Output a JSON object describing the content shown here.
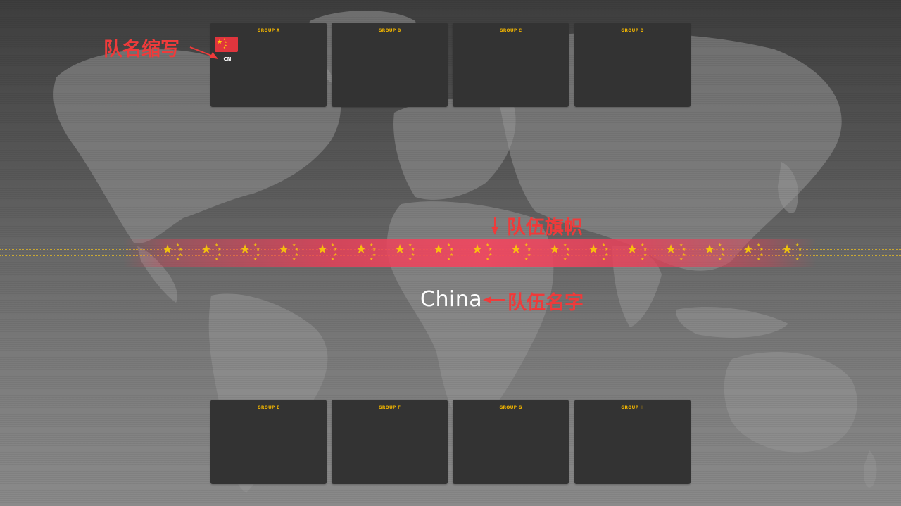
{
  "groups_top": [
    {
      "title": "GROUP A",
      "teams": [
        {
          "abbr": "CN",
          "flag": "china-flag-icon"
        }
      ]
    },
    {
      "title": "GROUP B",
      "teams": []
    },
    {
      "title": "GROUP C",
      "teams": []
    },
    {
      "title": "GROUP D",
      "teams": []
    }
  ],
  "groups_bottom": [
    {
      "title": "GROUP E",
      "teams": []
    },
    {
      "title": "GROUP F",
      "teams": []
    },
    {
      "title": "GROUP G",
      "teams": []
    },
    {
      "title": "GROUP H",
      "teams": []
    }
  ],
  "featured_team": {
    "name": "China",
    "flag_icon": "china-flag-icon",
    "flag_color": "#e0353d",
    "star_color": "#ffd400"
  },
  "annotations": {
    "abbr_label": "队名缩写",
    "flag_label": "队伍旗帜",
    "name_label": "队伍名字"
  },
  "colors": {
    "group_title": "#f0b400",
    "card_bg": "#333333",
    "annotation": "#ee3b3b",
    "banner": "#ec3e58"
  }
}
